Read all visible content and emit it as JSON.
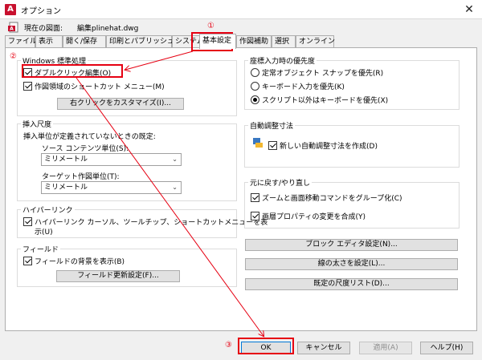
{
  "window": {
    "title": "オプション",
    "close_glyph": "✕"
  },
  "profile": {
    "label": "現在の図面:",
    "drawing_value": "編集plinehat.dwg"
  },
  "tabs": [
    {
      "label": "ファイル"
    },
    {
      "label": "表示"
    },
    {
      "label": "開く/保存"
    },
    {
      "label": "印刷とパブリッシュ"
    },
    {
      "label": "システム"
    },
    {
      "label": "基本設定"
    },
    {
      "label": "作図補助"
    },
    {
      "label": "選択"
    },
    {
      "label": "オンライン"
    }
  ],
  "active_tab": "基本設定",
  "windows_std": {
    "title": "Windows 標準処理",
    "double_click": {
      "label": "ダブルクリック編集(O)",
      "checked": true
    },
    "shortcut_menu": {
      "label": "作図領域のショートカット メニュー(M)",
      "checked": true
    },
    "customize_button": "右クリックをカスタマイズ(I)..."
  },
  "insert_scale": {
    "title": "挿入尺度",
    "sub_label": "挿入単位が定義されていないときの既定:",
    "source_label": "ソース コンテンツ単位(S):",
    "source_value": "ミリメートル",
    "target_label": "ターゲット作図単位(T):",
    "target_value": "ミリメートル"
  },
  "hyperlink": {
    "title": "ハイパーリンク",
    "line1": "ハイパーリンク カーソル、ツールチップ、ショートカットメニューを表",
    "line2": "示(U)",
    "checked": true
  },
  "field": {
    "title": "フィールド",
    "bg_label": "フィールドの背景を表示(B)",
    "checked": true,
    "update_button": "フィールド更新設定(F)..."
  },
  "coord_input": {
    "title": "座標入力時の優先度",
    "options": [
      {
        "label": "定常オブジェクト スナップを優先(R)",
        "selected": false
      },
      {
        "label": "キーボード入力を優先(K)",
        "selected": false
      },
      {
        "label": "スクリプト以外はキーボードを優先(X)",
        "selected": true
      }
    ]
  },
  "assoc_dim": {
    "title": "自動調整寸法",
    "label": "新しい自動調整寸法を作成(D)",
    "checked": true
  },
  "undo_redo": {
    "title": "元に戻す/やり直し",
    "zoom_group": {
      "label": "ズームと画面移動コマンドをグループ化(C)",
      "checked": true
    },
    "layer_combine": {
      "label": "画層プロパティの変更を合成(Y)",
      "checked": true
    }
  },
  "right_buttons": {
    "block_editor": "ブロック エディタ設定(N)...",
    "lineweight": "線の太さを設定(L)...",
    "default_scale": "既定の尺度リスト(D)..."
  },
  "bottom_buttons": {
    "ok": "OK",
    "cancel": "キャンセル",
    "apply": "適用(A)",
    "help": "ヘルプ(H)"
  },
  "annotations": {
    "num1": "①",
    "num2": "②",
    "num3": "③",
    "color": "#e60012"
  }
}
